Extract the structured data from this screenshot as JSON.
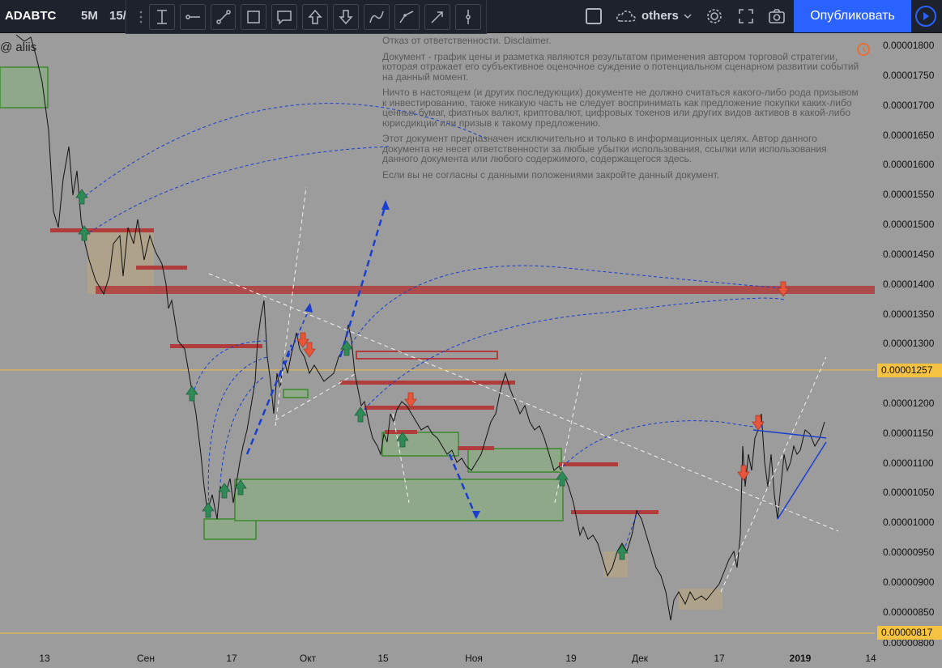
{
  "toolbar": {
    "symbol": "ADABTC",
    "interval": "5M",
    "interval_partial": "15/",
    "others_label": "others",
    "publish_label": "Опубликовать",
    "draw_tools": [
      "cursor-text-icon",
      "horizontal-ray-icon",
      "trend-line-icon",
      "rectangle-icon",
      "callout-icon",
      "arrow-up-icon",
      "arrow-down-icon",
      "curve-icon",
      "path-icon",
      "arrow-line-icon",
      "vertical-line-icon"
    ]
  },
  "watermark": "@ aliis",
  "disclaimer": {
    "title": "Отказ от ответственности. Disclaimer.",
    "p1": "Документ - график цены и разметка являются результатом применения автором торговой стратегии, которая отражает его субъективное оценочное суждение о потенциальном сценарном развитии событий на данный момент.",
    "p2": "Ничто в настоящем (и других последующих) документе не должно считаться какого-либо рода призывом к инвестированию, также никакую часть не следует воспринимать как предложение покупки каких-либо ценных бумаг, фиатных валют, криптовалют, цифровых токенов или других видов активов в какой-либо юрисдикции или призыв к такому предложению.",
    "p3": "Этот документ предназначен исключительно и только в информационных целях. Автор данного документа не несет ответственности за любые убытки использования, ссылки или использования данного документа или любого содержимого, содержащегося здесь.",
    "p4": "Если вы не согласны с данными положениями закройте данный документ."
  },
  "price_axis": {
    "labels": [
      "0.00001800",
      "0.00001750",
      "0.00001700",
      "0.00001650",
      "0.00001600",
      "0.00001550",
      "0.00001500",
      "0.00001450",
      "0.00001400",
      "0.00001350",
      "0.00001300",
      "0.00001250",
      "0.00001200",
      "0.00001150",
      "0.00001100",
      "0.00001050",
      "0.00001000",
      "0.00000950",
      "0.00000900",
      "0.00000850",
      "0.00000800"
    ],
    "tag_upper": "0.00001257",
    "tag_lower": "0.00000817"
  },
  "time_axis": {
    "labels": [
      "13",
      "Сен",
      "17",
      "Окт",
      "15",
      "Ноя",
      "19",
      "Дек",
      "17",
      "2019",
      "14"
    ]
  },
  "colors": {
    "background": "#9c9c9c",
    "topbar": "#1e222d",
    "accent": "#2962ff",
    "resistance": "#b03c3c",
    "support_zone": "#3a8a2a",
    "up_arrow": "#2e8b57",
    "down_arrow": "#e8553a",
    "price_tag": "#f5c242"
  }
}
